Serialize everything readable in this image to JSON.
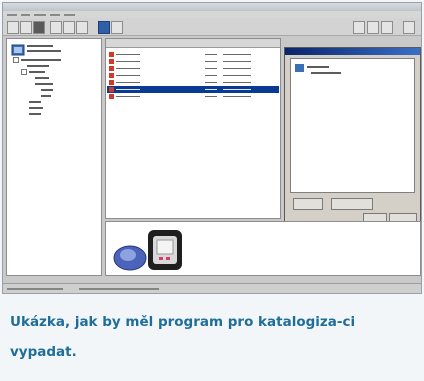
{
  "caption": "Ukázka, jak by měl program pro katalogiza-ci vypadat.",
  "colors": {
    "caption": "#1f6e9a",
    "selection": "#0a3a93",
    "dialog_title": "#0a246a",
    "file_icon": "#d03a2a",
    "background": "#f2f6f9"
  },
  "file_rows": {
    "count": 7,
    "selected_index": 5
  },
  "icons": [
    "folder-tree-icon",
    "file-icon",
    "flash-player-device-icon"
  ]
}
